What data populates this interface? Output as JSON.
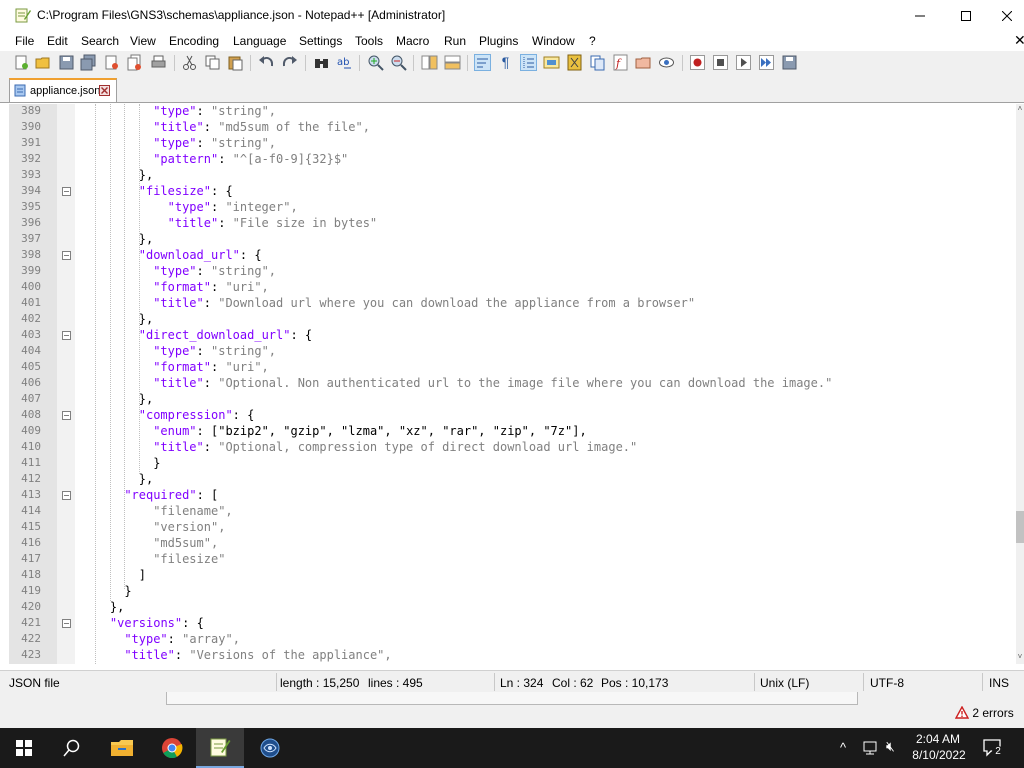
{
  "window": {
    "title": "C:\\Program Files\\GNS3\\schemas\\appliance.json - Notepad++ [Administrator]"
  },
  "menu": [
    "File",
    "Edit",
    "Search",
    "View",
    "Encoding",
    "Language",
    "Settings",
    "Tools",
    "Macro",
    "Run",
    "Plugins",
    "Window",
    "?"
  ],
  "tab": {
    "label": "appliance.json"
  },
  "colors": {
    "keyword": "#8000ff",
    "string": "#808080",
    "tab_accent": "#f0a030",
    "error": "#cc2020"
  },
  "editor": {
    "lines": [
      {
        "n": "389",
        "fold": false,
        "indent": 10,
        "k": "\"type\"",
        "p": ": ",
        "v": "\"string\",",
        "t": ""
      },
      {
        "n": "390",
        "fold": false,
        "indent": 10,
        "k": "\"title\"",
        "p": ": ",
        "v": "\"md5sum of the file\",",
        "t": ""
      },
      {
        "n": "391",
        "fold": false,
        "indent": 10,
        "k": "\"type\"",
        "p": ": ",
        "v": "\"string\",",
        "t": ""
      },
      {
        "n": "392",
        "fold": false,
        "indent": 10,
        "k": "\"pattern\"",
        "p": ": ",
        "v": "\"^[a-f0-9]{32}$\"",
        "t": ""
      },
      {
        "n": "393",
        "fold": false,
        "indent": 8,
        "k": "",
        "p": "},",
        "v": "",
        "t": ""
      },
      {
        "n": "394",
        "fold": true,
        "indent": 8,
        "k": "\"filesize\"",
        "p": ": {",
        "v": "",
        "t": ""
      },
      {
        "n": "395",
        "fold": false,
        "indent": 12,
        "k": "\"type\"",
        "p": ": ",
        "v": "\"integer\",",
        "t": ""
      },
      {
        "n": "396",
        "fold": false,
        "indent": 12,
        "k": "\"title\"",
        "p": ": ",
        "v": "\"File size in bytes\"",
        "t": ""
      },
      {
        "n": "397",
        "fold": false,
        "indent": 8,
        "k": "",
        "p": "},",
        "v": "",
        "t": ""
      },
      {
        "n": "398",
        "fold": true,
        "indent": 8,
        "k": "\"download_url\"",
        "p": ": {",
        "v": "",
        "t": ""
      },
      {
        "n": "399",
        "fold": false,
        "indent": 10,
        "k": "\"type\"",
        "p": ": ",
        "v": "\"string\",",
        "t": ""
      },
      {
        "n": "400",
        "fold": false,
        "indent": 10,
        "k": "\"format\"",
        "p": ": ",
        "v": "\"uri\",",
        "t": ""
      },
      {
        "n": "401",
        "fold": false,
        "indent": 10,
        "k": "\"title\"",
        "p": ": ",
        "v": "\"Download url where you can download the appliance from a browser\"",
        "t": ""
      },
      {
        "n": "402",
        "fold": false,
        "indent": 8,
        "k": "",
        "p": "},",
        "v": "",
        "t": ""
      },
      {
        "n": "403",
        "fold": true,
        "indent": 8,
        "k": "\"direct_download_url\"",
        "p": ": {",
        "v": "",
        "t": ""
      },
      {
        "n": "404",
        "fold": false,
        "indent": 10,
        "k": "\"type\"",
        "p": ": ",
        "v": "\"string\",",
        "t": ""
      },
      {
        "n": "405",
        "fold": false,
        "indent": 10,
        "k": "\"format\"",
        "p": ": ",
        "v": "\"uri\",",
        "t": ""
      },
      {
        "n": "406",
        "fold": false,
        "indent": 10,
        "k": "\"title\"",
        "p": ": ",
        "v": "\"Optional. Non authenticated url to the image file where you can download the image.\"",
        "t": ""
      },
      {
        "n": "407",
        "fold": false,
        "indent": 8,
        "k": "",
        "p": "},",
        "v": "",
        "t": ""
      },
      {
        "n": "408",
        "fold": true,
        "indent": 8,
        "k": "\"compression\"",
        "p": ": {",
        "v": "",
        "t": ""
      },
      {
        "n": "409",
        "fold": false,
        "indent": 10,
        "k": "\"enum\"",
        "p": ": ",
        "v": "[\"bzip2\", \"gzip\", \"lzma\", \"xz\", \"rar\", \"zip\", \"7z\"],",
        "t": ""
      },
      {
        "n": "410",
        "fold": false,
        "indent": 10,
        "k": "\"title\"",
        "p": ": ",
        "v": "\"Optional, compression type of direct download url image.\"",
        "t": ""
      },
      {
        "n": "411",
        "fold": false,
        "indent": 10,
        "k": "",
        "p": "}",
        "v": "",
        "t": ""
      },
      {
        "n": "412",
        "fold": false,
        "indent": 8,
        "k": "",
        "p": "},",
        "v": "",
        "t": ""
      },
      {
        "n": "413",
        "fold": true,
        "indent": 6,
        "k": "\"required\"",
        "p": ": [",
        "v": "",
        "t": ""
      },
      {
        "n": "414",
        "fold": false,
        "indent": 10,
        "k": "",
        "p": "",
        "v": "\"filename\",",
        "t": ""
      },
      {
        "n": "415",
        "fold": false,
        "indent": 10,
        "k": "",
        "p": "",
        "v": "\"version\",",
        "t": ""
      },
      {
        "n": "416",
        "fold": false,
        "indent": 10,
        "k": "",
        "p": "",
        "v": "\"md5sum\",",
        "t": ""
      },
      {
        "n": "417",
        "fold": false,
        "indent": 10,
        "k": "",
        "p": "",
        "v": "\"filesize\"",
        "t": ""
      },
      {
        "n": "418",
        "fold": false,
        "indent": 8,
        "k": "",
        "p": "]",
        "v": "",
        "t": ""
      },
      {
        "n": "419",
        "fold": false,
        "indent": 6,
        "k": "",
        "p": "}",
        "v": "",
        "t": ""
      },
      {
        "n": "420",
        "fold": false,
        "indent": 4,
        "k": "",
        "p": "},",
        "v": "",
        "t": ""
      },
      {
        "n": "421",
        "fold": true,
        "indent": 4,
        "k": "\"versions\"",
        "p": ": {",
        "v": "",
        "t": ""
      },
      {
        "n": "422",
        "fold": false,
        "indent": 6,
        "k": "\"type\"",
        "p": ": ",
        "v": "\"array\",",
        "t": ""
      },
      {
        "n": "423",
        "fold": false,
        "indent": 6,
        "k": "\"title\"",
        "p": ": ",
        "v": "\"Versions of the appliance\",",
        "t": ""
      }
    ]
  },
  "status": {
    "filetype": "JSON file",
    "length": "length : 15,250",
    "lines": "lines : 495",
    "ln": "Ln : 324",
    "col": "Col : 62",
    "pos": "Pos : 10,173",
    "eol": "Unix (LF)",
    "encoding": "UTF-8",
    "mode": "INS"
  },
  "errors": {
    "label": "2 errors"
  },
  "taskbar": {
    "time": "2:04 AM",
    "date": "8/10/2022",
    "notification_count": "2"
  }
}
